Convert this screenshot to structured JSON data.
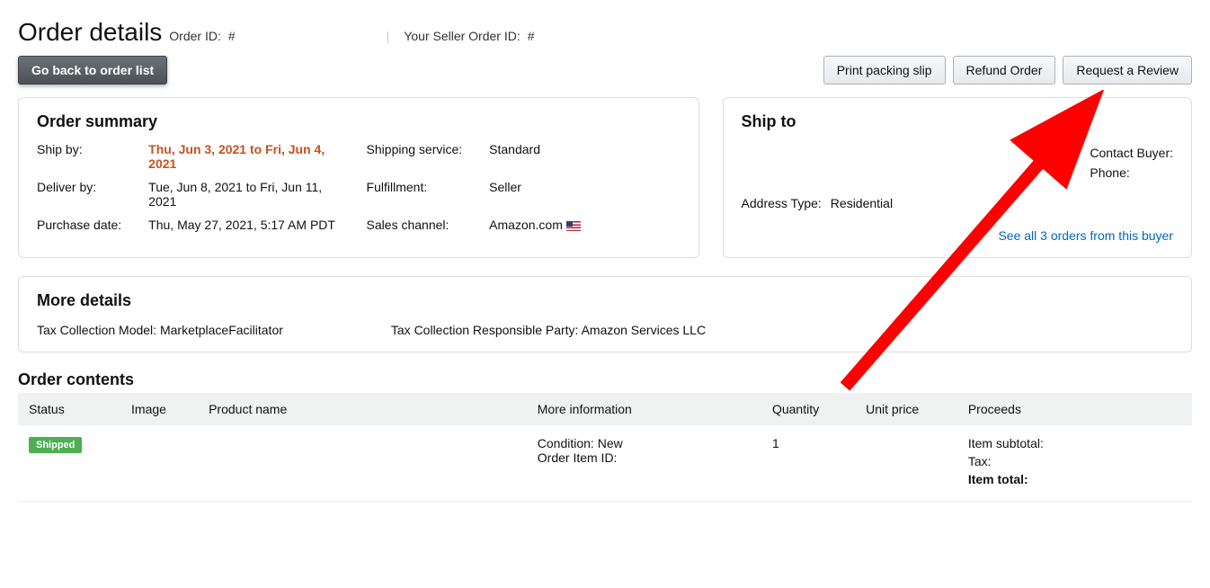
{
  "header": {
    "title": "Order details",
    "order_id_label": "Order ID:",
    "order_id_value": "#",
    "seller_order_id_label": "Your Seller Order ID:",
    "seller_order_id_value": "#"
  },
  "actions": {
    "back": "Go back to order list",
    "print": "Print packing slip",
    "refund": "Refund Order",
    "request_review": "Request a Review"
  },
  "order_summary": {
    "title": "Order summary",
    "ship_by_label": "Ship by:",
    "ship_by_value": "Thu, Jun 3, 2021 to Fri, Jun 4, 2021",
    "deliver_by_label": "Deliver by:",
    "deliver_by_value": "Tue, Jun 8, 2021 to Fri, Jun 11, 2021",
    "purchase_date_label": "Purchase date:",
    "purchase_date_value": "Thu, May 27, 2021, 5:17 AM PDT",
    "shipping_service_label": "Shipping service:",
    "shipping_service_value": "Standard",
    "fulfillment_label": "Fulfillment:",
    "fulfillment_value": "Seller",
    "sales_channel_label": "Sales channel:",
    "sales_channel_value": "Amazon.com"
  },
  "ship_to": {
    "title": "Ship to",
    "address_type_label": "Address Type:",
    "address_type_value": "Residential",
    "contact_buyer_label": "Contact Buyer:",
    "phone_label": "Phone:",
    "see_orders_link": "See all 3 orders from this buyer"
  },
  "more_details": {
    "title": "More details",
    "tax_model_label": "Tax Collection Model:",
    "tax_model_value": "MarketplaceFacilitator",
    "tax_party_label": "Tax Collection Responsible Party:",
    "tax_party_value": "Amazon Services LLC"
  },
  "order_contents": {
    "title": "Order contents",
    "headers": {
      "status": "Status",
      "image": "Image",
      "product_name": "Product name",
      "more_info": "More information",
      "quantity": "Quantity",
      "unit_price": "Unit price",
      "proceeds": "Proceeds"
    },
    "row": {
      "status_badge": "Shipped",
      "condition_label": "Condition:",
      "condition_value": "New",
      "order_item_id_label": "Order Item ID:",
      "quantity": "1",
      "proceeds_subtotal": "Item subtotal:",
      "proceeds_tax": "Tax:",
      "proceeds_total": "Item total:"
    }
  }
}
